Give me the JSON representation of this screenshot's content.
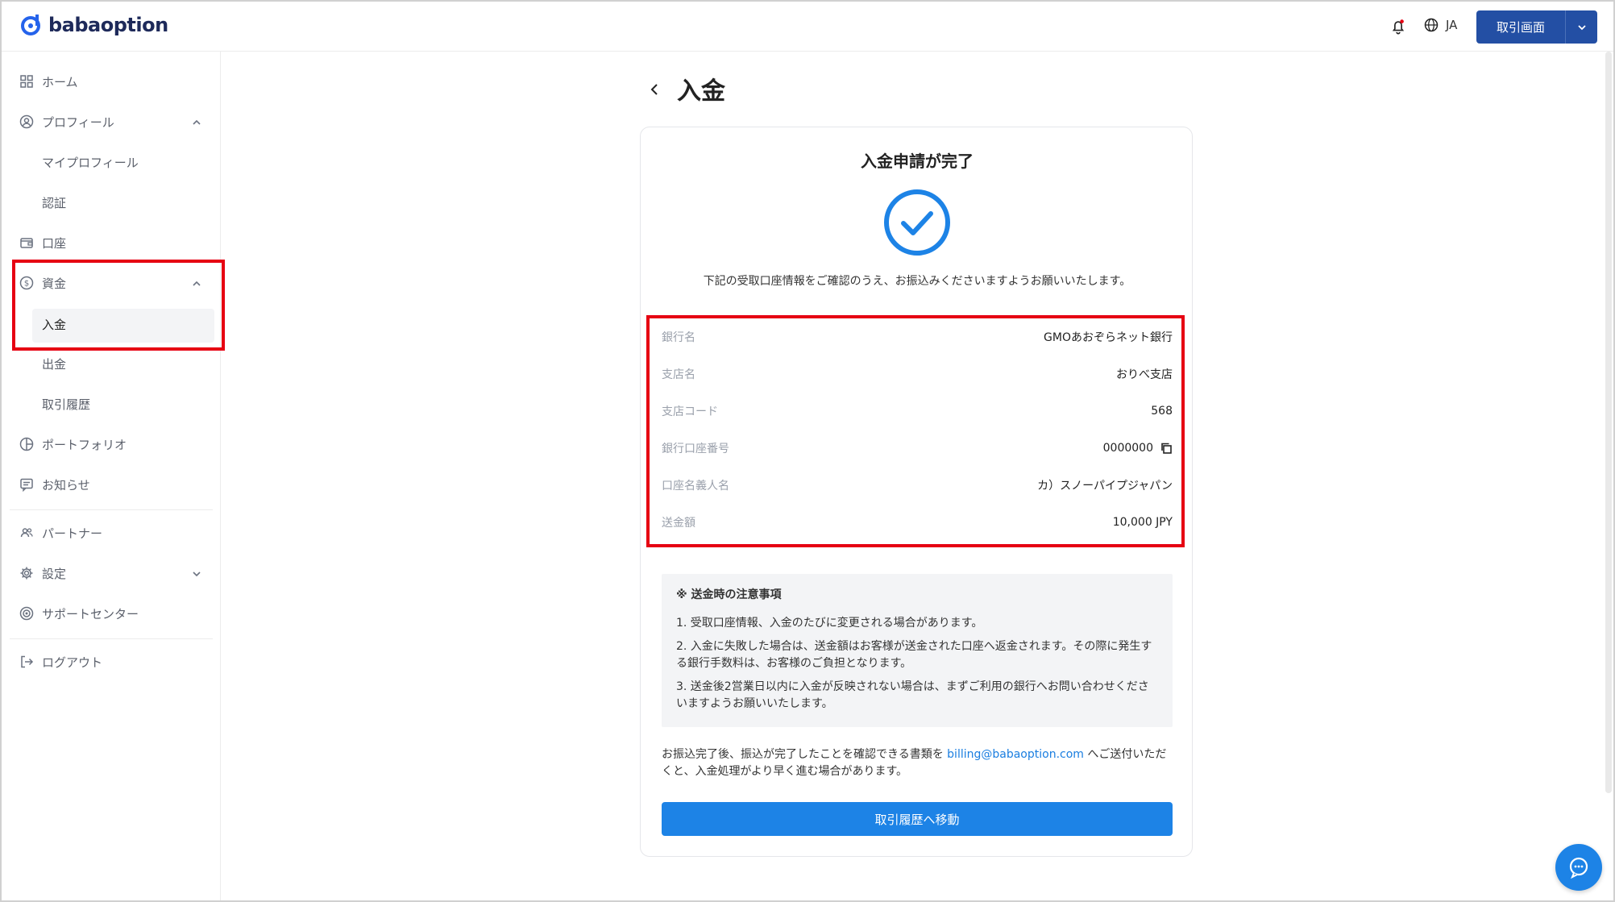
{
  "brand": {
    "name": "babaoption"
  },
  "header": {
    "language": "JA",
    "trade_button": "取引画面"
  },
  "sidebar": {
    "home": "ホーム",
    "profile": "プロフィール",
    "my_profile": "マイプロフィール",
    "verification": "認証",
    "account": "口座",
    "funds": "資金",
    "deposit": "入金",
    "withdraw": "出金",
    "history": "取引履歴",
    "portfolio": "ポートフォリオ",
    "news": "お知らせ",
    "partner": "パートナー",
    "settings": "設定",
    "support": "サポートセンター",
    "logout": "ログアウト"
  },
  "main": {
    "page_title": "入金",
    "card_title": "入金申請が完了",
    "description": "下記の受取口座情報をご確認のうえ、お振込みくださいますようお願いいたします。",
    "info": [
      {
        "label": "銀行名",
        "value": "GMOあおぞらネット銀行"
      },
      {
        "label": "支店名",
        "value": "おりべ支店"
      },
      {
        "label": "支店コード",
        "value": "568"
      },
      {
        "label": "銀行口座番号",
        "value": "0000000"
      },
      {
        "label": "口座名義人名",
        "value": "カ）スノーパイプジャパン"
      },
      {
        "label": "送金額",
        "value": "10,000 JPY"
      }
    ],
    "notice": {
      "title": "※ 送金時の注意事項",
      "items": [
        "1. 受取口座情報、入金のたびに変更される場合があります。",
        "2. 入金に失敗した場合は、送金額はお客様が送金された口座へ返金されます。その際に発生する銀行手数料は、お客様のご負担となります。",
        "3. 送金後2営業日以内に入金が反映されない場合は、まずご利用の銀行へお問い合わせくださいますようお願いいたします。"
      ]
    },
    "footer_before": "お振込完了後、振込が完了したことを確認できる書類を ",
    "footer_email": "billing@babaoption.com",
    "footer_after": " へご送付いただくと、入金処理がより早く進む場合があります。",
    "primary_button": "取引履歴へ移動"
  }
}
